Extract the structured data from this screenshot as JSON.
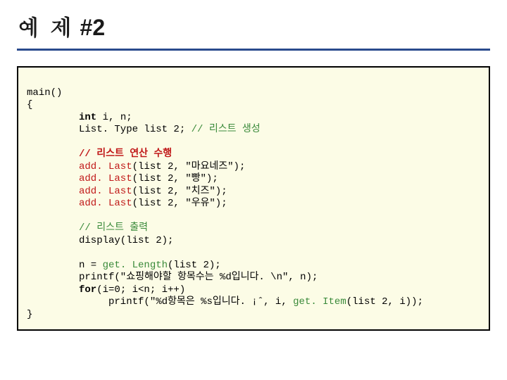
{
  "title_kr": "예 제",
  "title_num": "#2",
  "code": {
    "l1": "main()",
    "l2": "{",
    "int_kw": "int",
    "l3_rest": " i, n;",
    "l4a": "List. Type ",
    "l4_id": "list 2",
    "l4b": "; ",
    "l4_cm": "// 리스트 생성",
    "blk1_cm": "// 리스트 연산 수행",
    "a1a": "add. Last",
    "a1b": "(list 2, \"마요네즈\");",
    "a2b": "(list 2, \"빵\");",
    "a3b": "(list 2, \"치즈\");",
    "a4b": "(list 2, \"우유\");",
    "blk2_cm": "// 리스트 출력",
    "d1": "display(list 2);",
    "n1a": "n = ",
    "n1b": "get. Length",
    "n1c": "(list 2);",
    "p1": "printf(\"쇼핑해야할 항목수는 %d입니다. \\n\", n);",
    "for_kw": "for",
    "for_rest": "(i=0; i<n; i++)",
    "p2a": "     printf(\"%d항목은 %s입니다. ¡ˆ, i, ",
    "p2b": "get. Item",
    "p2c": "(list 2, i));",
    "lend": "}"
  }
}
